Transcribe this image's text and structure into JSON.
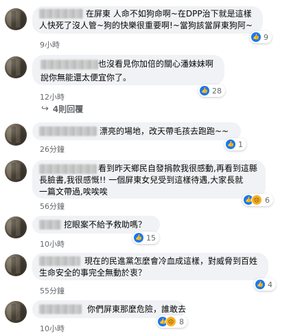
{
  "comments": [
    {
      "line1": "在屏東 人命不如狗命啊~在DPP治下就是這樣",
      "line2": "人快死了沒人管~狗的快樂很重要啊!~當狗該當屏東狗阿~",
      "time": "9小時",
      "reactions": "9"
    },
    {
      "line1": "也沒看見你加倍的關心潘妹妹啊",
      "line2": "說你無能還太便宜你了。",
      "time": "12小時",
      "reactions": "28"
    },
    {
      "line1": "漂亮的場地，改天帶毛孩去跑跑~~",
      "time": "26分鐘",
      "reactions": "1"
    },
    {
      "line1": "看到昨天鄉民自發捐款我很感動,再看到這縣",
      "line2": "長臉書,我很感慨!! 一個屏東女兒受到這樣待遇,大家長就",
      "line3": "一篇文帶過,唉唉唉",
      "time": "56分鐘",
      "reactions": "6"
    },
    {
      "line1": "挖眼案不給予救助嗎？",
      "time": "10小時",
      "reactions": "15"
    },
    {
      "line1": "現在的民進黨怎麼會冷血成這樣，對威脅到百姓",
      "line2": "生命安全的事完全無動於衷？",
      "time": "55分鐘",
      "reactions": "4"
    },
    {
      "line1": "你們屏東那麼危險，誰敢去",
      "time": "10小時",
      "reactions": "8"
    }
  ],
  "replies_link": "4則回覆",
  "icons": {
    "like": "like-icon",
    "sad": "sad-icon",
    "reply_arrow": "reply-arrow-icon"
  },
  "colors": {
    "like_blue": "#1877f2",
    "bubble_bg": "#f0f2f5",
    "meta_gray": "#65676b"
  }
}
